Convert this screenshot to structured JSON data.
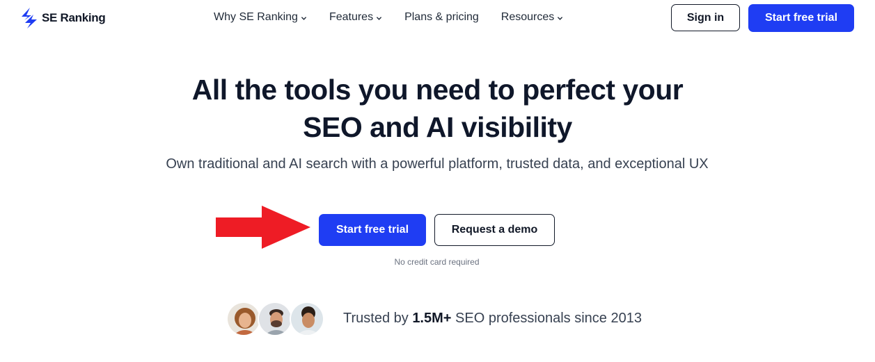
{
  "brand": {
    "name": "SE Ranking",
    "color": "#1f3df3"
  },
  "nav": {
    "items": [
      {
        "label": "Why SE Ranking",
        "has_dropdown": true
      },
      {
        "label": "Features",
        "has_dropdown": true
      },
      {
        "label": "Plans & pricing",
        "has_dropdown": false
      },
      {
        "label": "Resources",
        "has_dropdown": true
      }
    ],
    "sign_in_label": "Sign in",
    "start_trial_label": "Start free trial"
  },
  "hero": {
    "headline_line1": "All the tools you need to perfect your",
    "headline_line2": "SEO and AI visibility",
    "subheadline": "Own traditional and AI search with a powerful platform, trusted data, and exceptional UX",
    "primary_cta": "Start free trial",
    "secondary_cta": "Request a demo",
    "cta_note": "No credit card required",
    "annotation_arrow_color": "#ee1c25"
  },
  "trust": {
    "prefix": "Trusted by",
    "count": "1.5M+",
    "suffix": "SEO professionals since 2013",
    "avatars": [
      "avatar-woman-curly-hair",
      "avatar-man-beard",
      "avatar-man-curly-hair"
    ]
  }
}
